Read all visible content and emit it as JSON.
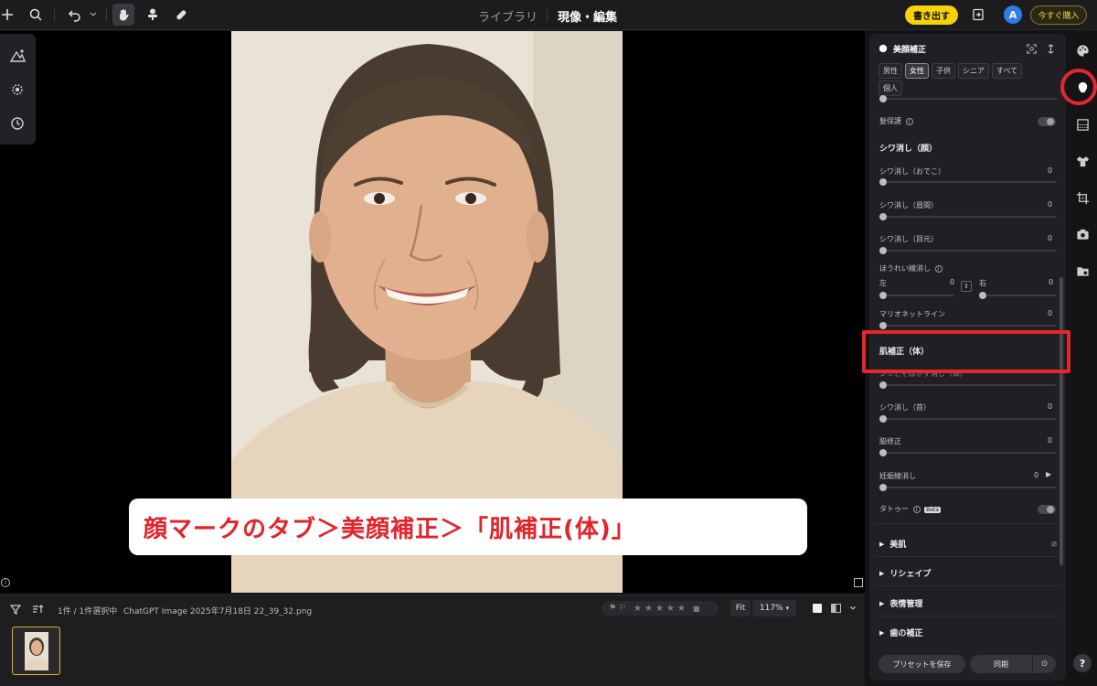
{
  "topbar": {
    "tabs": [
      {
        "label": "ライブラリ",
        "active": false
      },
      {
        "label": "現像・編集",
        "active": true
      }
    ],
    "export_label": "書き出す",
    "avatar_letter": "A",
    "buy_label": "今すぐ購入",
    "icons": [
      "plus-icon",
      "search-icon",
      "undo-icon",
      "chevron-down-icon",
      "hand-icon",
      "stamp-icon",
      "bandage-icon",
      "compare-icon"
    ]
  },
  "left_tools": [
    "auto-enhance-icon",
    "sun-icon",
    "history-icon"
  ],
  "caption": "顔マークのタブ＞美顔補正＞「肌補正(体)」",
  "filmstrip": {
    "selection_text": "1件 / 1件選択中",
    "filename": "ChatGPT Image 2025年7月18日 22_39_32.png",
    "fit_label": "Fit",
    "zoom_label": "117%",
    "stars": 5
  },
  "panel": {
    "title": "美顔補正",
    "chips_row1": [
      {
        "label": "男性",
        "active": false
      },
      {
        "label": "女性",
        "active": true
      },
      {
        "label": "子供",
        "active": false
      },
      {
        "label": "シニア",
        "active": false
      },
      {
        "label": "すべて",
        "active": false
      }
    ],
    "chips_row2": [
      {
        "label": "個人",
        "active": false
      }
    ],
    "hair_protect": "髪保護",
    "wrinkle_face_head": "シワ消し（顔）",
    "sliders_face": [
      {
        "label": "シワ消し（おでこ）",
        "value": "0"
      },
      {
        "label": "シワ消し（眉間）",
        "value": "0"
      },
      {
        "label": "シワ消し（目元）",
        "value": "0"
      }
    ],
    "nasolabial": {
      "label": "ほうれい線消し",
      "left_label": "左",
      "left_value": "0",
      "right_label": "右",
      "right_value": "0"
    },
    "marionette": {
      "label": "マリオネットライン",
      "value": "0"
    },
    "skin_body_head": "肌補正（体）",
    "sliders_body": [
      {
        "label": "シワ消し（首）",
        "value": "0"
      },
      {
        "label": "脇修正",
        "value": "0"
      },
      {
        "label": "妊娠線消し",
        "value": "0"
      }
    ],
    "tattoo": {
      "label": "タトゥー",
      "badge": "Beta"
    },
    "collapsed_sections": [
      "美肌",
      "リシェイプ",
      "表情管理",
      "歯の補正"
    ],
    "preset_button": "プリセットを保存",
    "sync_button": "同期",
    "hidden_row_fragment": "シミとそばかす消し（体）"
  },
  "right_rail": [
    "palette-icon",
    "face-icon",
    "gradient-icon",
    "shirt-icon",
    "crop-icon",
    "camera-icon",
    "folder-icon"
  ],
  "colors": {
    "accent_yellow": "#f5d20a",
    "highlight_red": "#e5262b",
    "avatar_blue": "#2d7de6"
  }
}
